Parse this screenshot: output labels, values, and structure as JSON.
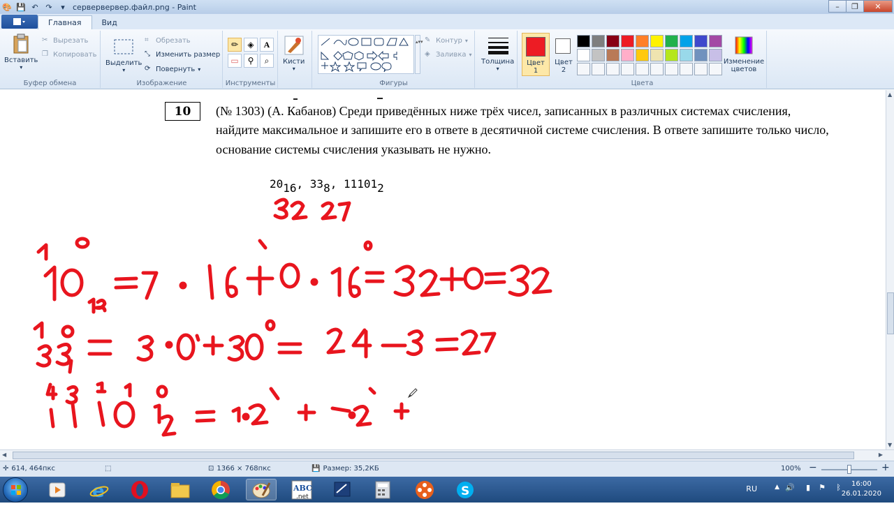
{
  "window": {
    "title": "сервервервер.файл.png - Paint",
    "min_label": "–",
    "max_label": "❐",
    "close_label": "✕"
  },
  "tabs": {
    "file_label": "",
    "items": [
      "Главная",
      "Вид"
    ]
  },
  "ribbon": {
    "clipboard": {
      "paste": "Вставить",
      "cut": "Вырезать",
      "copy": "Копировать",
      "label": "Буфер обмена"
    },
    "image": {
      "select": "Выделить",
      "crop": "Обрезать",
      "resize": "Изменить размер",
      "rotate": "Повернуть",
      "label": "Изображение"
    },
    "tools": {
      "label": "Инструменты"
    },
    "brushes": {
      "label": "Кисти"
    },
    "shapes": {
      "outline": "Контур",
      "fill": "Заливка",
      "label": "Фигуры"
    },
    "size": {
      "label": "Толщина"
    },
    "colors": {
      "color1_label": "Цвет",
      "color1_num": "1",
      "color2_label": "Цвет",
      "color2_num": "2",
      "color1": "#ed1c24",
      "color2": "#ffffff",
      "edit_label": "Изменение",
      "edit_label2": "цветов",
      "label": "Цвета",
      "palette": [
        "#000000",
        "#7f7f7f",
        "#880015",
        "#ed1c24",
        "#ff7f27",
        "#fff200",
        "#22b14c",
        "#00a2e8",
        "#3f48cc",
        "#a349a4",
        "#ffffff",
        "#c3c3c3",
        "#b97a57",
        "#ffaec9",
        "#ffc90e",
        "#efe4b0",
        "#b5e61d",
        "#99d9ea",
        "#7092be",
        "#c8bfe7",
        "#f5f7fa",
        "#f5f7fa",
        "#f5f7fa",
        "#f5f7fa",
        "#f5f7fa",
        "#f5f7fa",
        "#f5f7fa",
        "#f5f7fa",
        "#f5f7fa",
        "#f5f7fa"
      ]
    }
  },
  "document": {
    "task_number": "10",
    "task_text": "(№ 1303) (А. Кабанов) Среди приведённых ниже трёх чисел, записанных в различных системах счисления, найдите максимальное и запишите его в ответе в десятичной системе счисления. В ответе запишите только число, основание системы счисления указывать не нужно.",
    "num1": "20",
    "base1": "16",
    "num2": "33",
    "base2": "8",
    "num3": "11101",
    "base3": "2",
    "sep": ", ",
    "ink_color": "#e8151e"
  },
  "status": {
    "cursor_pos": "614, 464пкс",
    "image_size": "1366 × 768пкс",
    "file_size": "Размер: 35,2КБ",
    "zoom": "100%",
    "zoom_minus": "−",
    "zoom_plus": "+"
  },
  "taskbar": {
    "lang": "RU",
    "time": "16:00",
    "date": "26.01.2020"
  }
}
